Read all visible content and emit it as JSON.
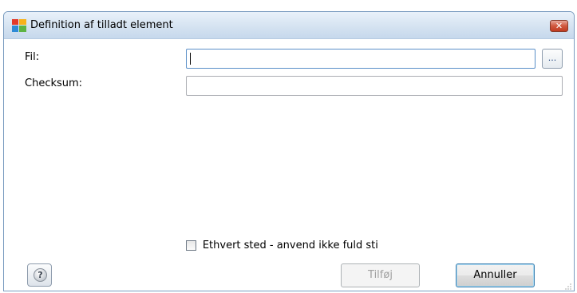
{
  "window": {
    "title": "Definition af tilladt element",
    "close_glyph": "✕",
    "icon": "avg-logo-icon"
  },
  "form": {
    "file_label": "Fil:",
    "file_value": "",
    "browse_label": "...",
    "checksum_label": "Checksum:",
    "checksum_value": ""
  },
  "option": {
    "anywhere_label": "Ethvert sted - anvend ikke fuld sti",
    "anywhere_checked": false
  },
  "buttons": {
    "help_glyph": "?",
    "add_label": "Tilføj",
    "cancel_label": "Annuller"
  },
  "colors": {
    "titlebar": "#d5e3f1",
    "close": "#c03c22",
    "focus_border": "#5a8fc8"
  }
}
